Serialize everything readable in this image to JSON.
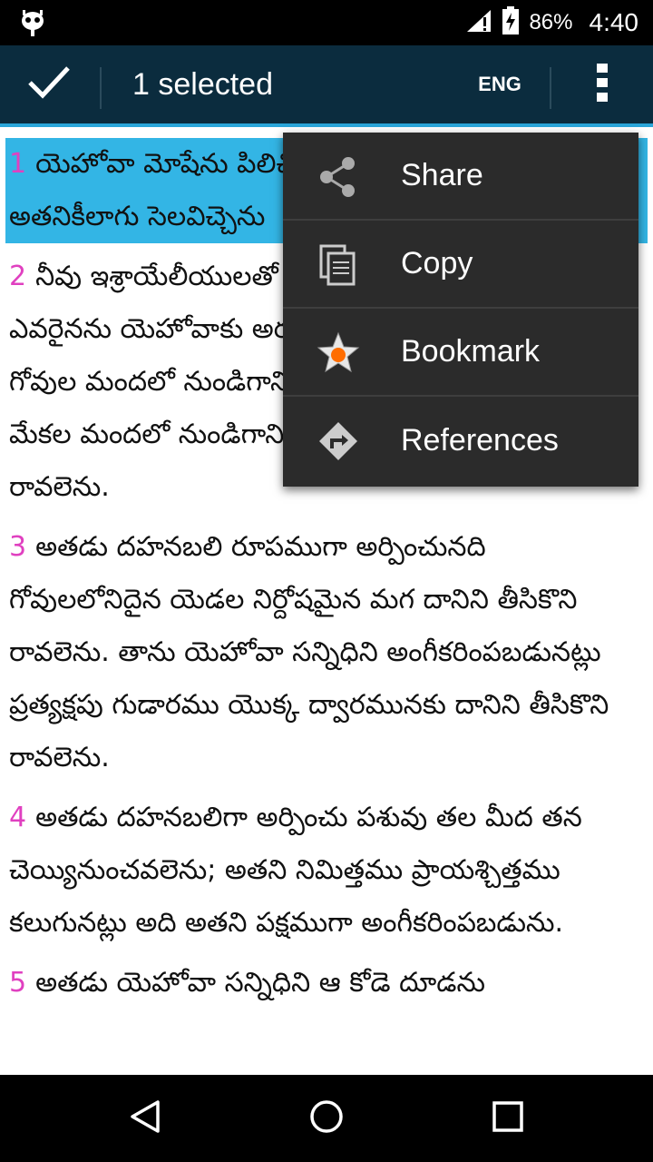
{
  "status_bar": {
    "battery_percent": "86%",
    "time": "4:40"
  },
  "action_bar": {
    "selected_label": "1 selected",
    "language_label": "ENG"
  },
  "verses": [
    {
      "num": "1",
      "text": "యెహోవా మోషేను పిలిచి ప్రత్యక్షపు గుడార ములో నుండి అతనికీలాగు సెలవిచ్చెను",
      "selected": true
    },
    {
      "num": "2",
      "text": "నీవు ఇశ్రాయేలీయులతో ఈలాగు చెప్పుము మీలో ఎవరైనను యెహోవాకు అర్పణము తీసికొని వచ్చునప్పుడు గోవుల మందలో నుండిగాని గొఱ్ఱెల మందలో నుండిగాని మేకల మందలో నుండిగాని మీ అర్పణమును తీసికొని రావలెను.",
      "selected": false
    },
    {
      "num": "3",
      "text": "అతడు దహనబలి రూపముగా అర్పించునది గోవులలోనిదైన యెడల నిర్దోషమైన మగ దానిని తీసికొని రావలెను. తాను యెహోవా సన్నిధిని అంగీకరింపబడునట్లు ప్రత్యక్షపు గుడారము యొక్క ద్వారమునకు దానిని తీసికొని రావలెను.",
      "selected": false
    },
    {
      "num": "4",
      "text": "అతడు దహనబలిగా అర్పించు పశువు తల మీద తన చెయ్యినుంచవలెను; అతని నిమిత్తము ప్రాయశ్చిత్తము కలుగునట్లు అది అతని పక్షముగా అంగీకరింపబడును.",
      "selected": false
    },
    {
      "num": "5",
      "text": "అతడు యెహోవా సన్నిధిని ఆ కోడె దూడను",
      "selected": false
    }
  ],
  "popup_menu": {
    "items": [
      {
        "label": "Share",
        "icon": "share-icon"
      },
      {
        "label": "Copy",
        "icon": "copy-icon"
      },
      {
        "label": "Bookmark",
        "icon": "bookmark-star-icon"
      },
      {
        "label": "References",
        "icon": "references-icon"
      }
    ]
  },
  "colors": {
    "action_bar": "#0b2c3e",
    "selection": "#33b5e5",
    "verse_number": "#e040c0",
    "menu_bg": "#2b2b2b"
  }
}
